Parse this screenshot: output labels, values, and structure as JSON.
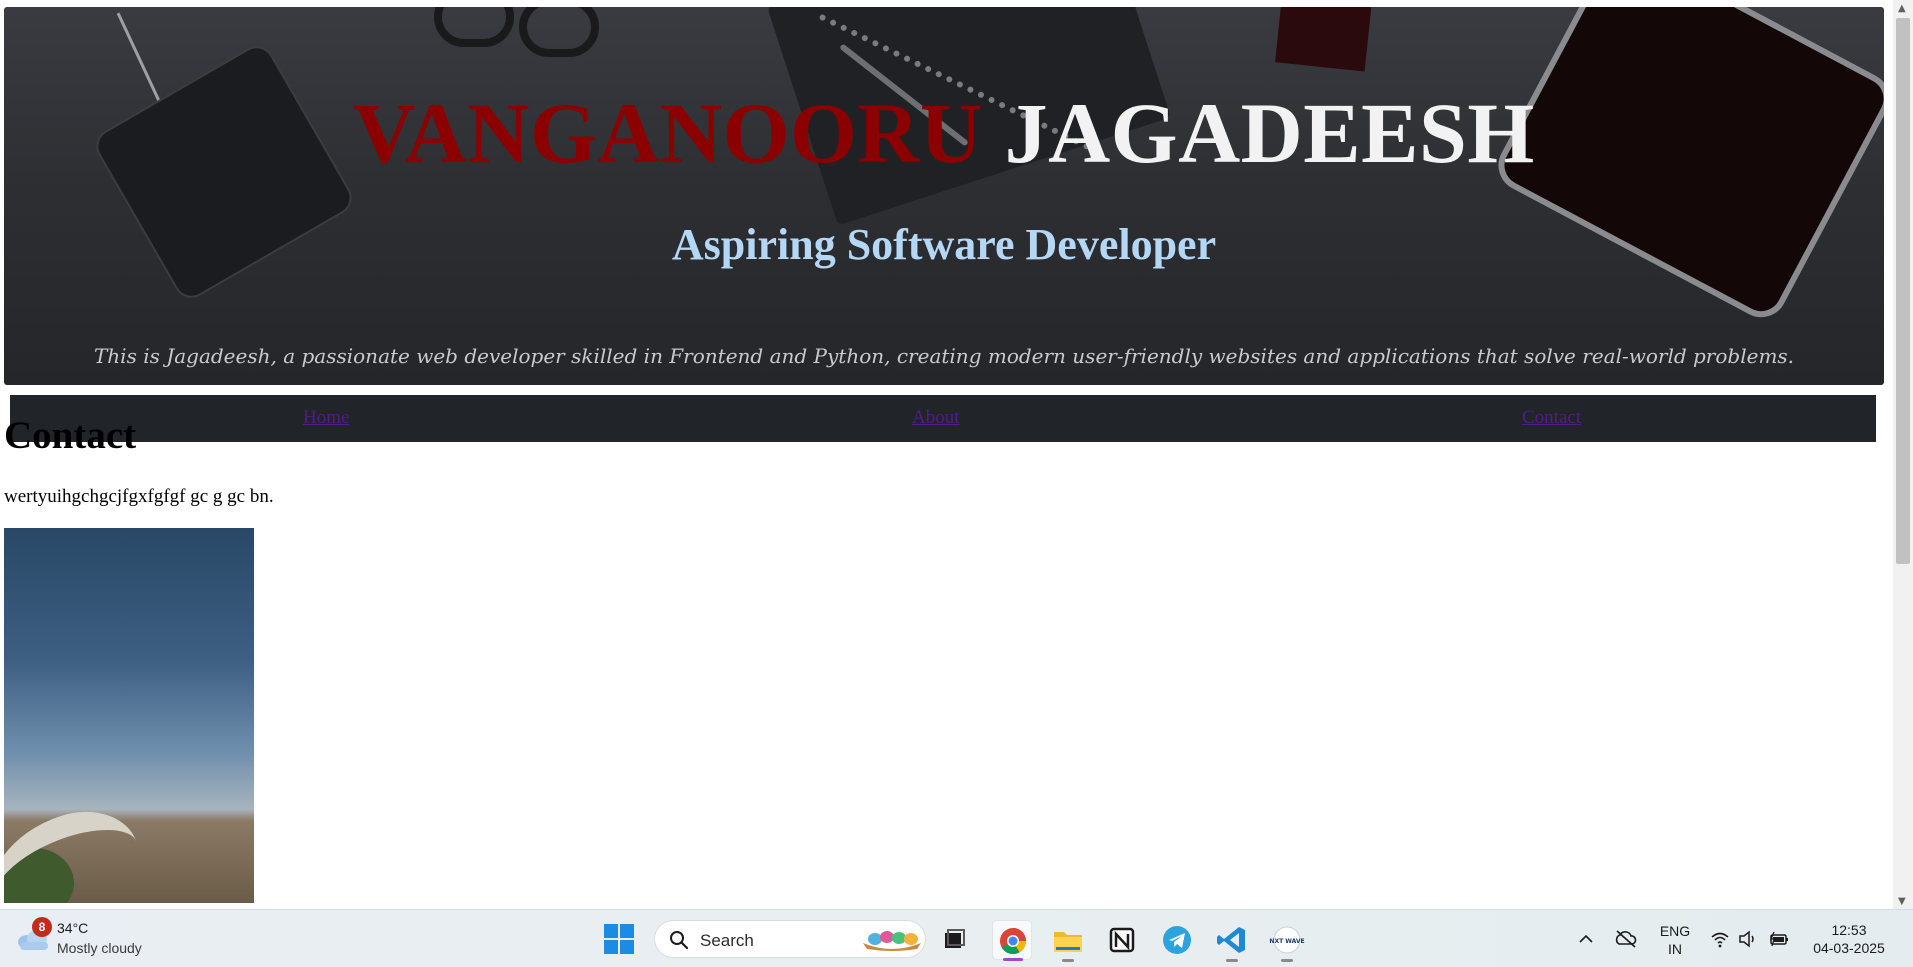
{
  "hero": {
    "first_name": "VANGANOORU",
    "last_name": "JAGADEESH",
    "subtitle": "Aspiring Software Developer",
    "description": "This is Jagadeesh, a passionate web developer skilled in Frontend and Python, creating modern user-friendly websites and applications that solve real-world problems.",
    "colors": {
      "first_name": "#8b0000",
      "last_name": "#f2f2f2",
      "subtitle": "#b3d7f5"
    }
  },
  "nav": {
    "items": [
      {
        "label": "Home"
      },
      {
        "label": "About"
      },
      {
        "label": "Contact"
      }
    ],
    "link_color": "#551a8b",
    "background": "#212529"
  },
  "section": {
    "title": "Contact",
    "text": "wertyuihgchgcjfgxfgfgf gc g gc bn."
  },
  "taskbar": {
    "weather": {
      "badge": "8",
      "temp": "34°C",
      "condition": "Mostly cloudy",
      "icon": "cloud-icon"
    },
    "search": {
      "placeholder": "Search"
    },
    "apps": [
      {
        "name": "Task View",
        "icon": "task-view-icon"
      },
      {
        "name": "Google Chrome",
        "icon": "chrome-icon"
      },
      {
        "name": "File Explorer",
        "icon": "folder-icon"
      },
      {
        "name": "Notion",
        "icon": "notion-icon"
      },
      {
        "name": "Telegram",
        "icon": "telegram-icon"
      },
      {
        "name": "Visual Studio Code",
        "icon": "vscode-icon"
      },
      {
        "name": "NxtWave",
        "icon": "nxtwave-icon",
        "label": "NXT WAVE"
      }
    ],
    "tray": {
      "lang_line1": "ENG",
      "lang_line2": "IN",
      "time": "12:53",
      "date": "04-03-2025"
    }
  }
}
